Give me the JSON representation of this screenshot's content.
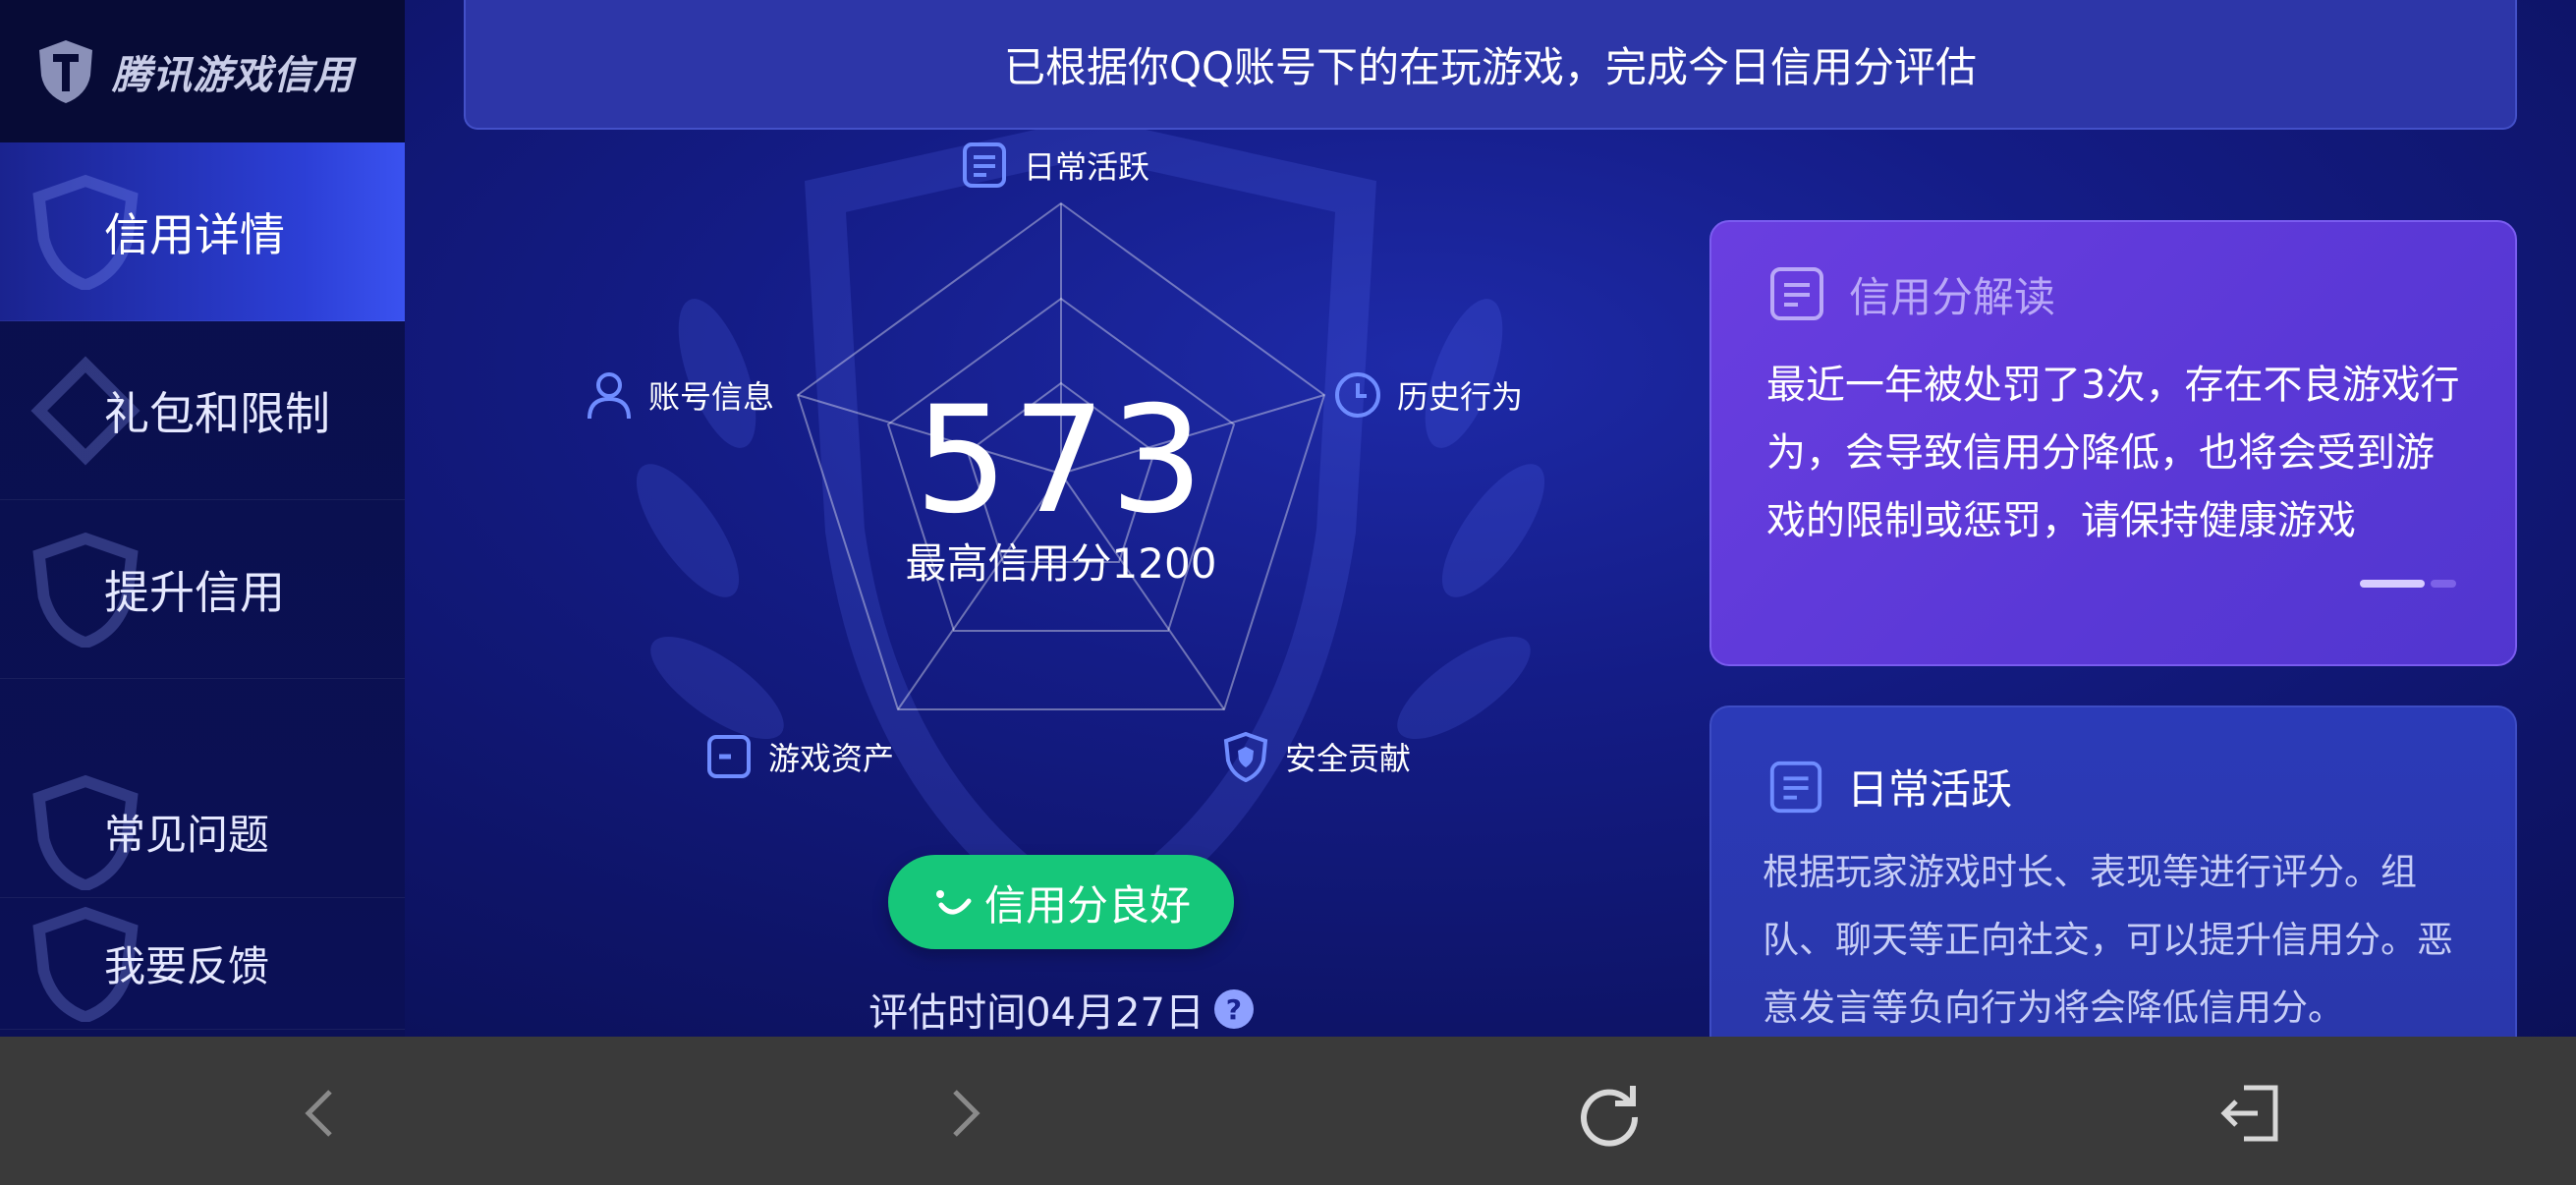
{
  "sidebar": {
    "logo_text": "腾讯游戏信用",
    "items": [
      {
        "label": "信用详情",
        "active": true
      },
      {
        "label": "礼包和限制"
      },
      {
        "label": "提升信用"
      },
      {
        "label": "常见问题"
      },
      {
        "label": "我要反馈"
      }
    ]
  },
  "banner": {
    "text": "已根据你QQ账号下的在玩游戏，完成今日信用分评估"
  },
  "radar": {
    "score": "573",
    "max_score": "最高信用分1200",
    "dimensions": {
      "daily": "日常活跃",
      "history": "历史行为",
      "security": "安全贡献",
      "assets": "游戏资产",
      "account": "账号信息"
    },
    "status_button": "信用分良好",
    "eval_time": "评估时间04月27日",
    "help_glyph": "?"
  },
  "cards": {
    "interpretation": {
      "title": "信用分解读",
      "body": "最近一年被处罚了3次，存在不良游戏行为，会导致信用分降低，也将会受到游戏的限制或惩罚，请保持健康游戏"
    },
    "daily": {
      "title": "日常活跃",
      "body": "根据玩家游戏时长、表现等进行评分。组队、聊天等正向社交，可以提升信用分。恶意发言等负向行为将会降低信用分。"
    }
  },
  "colors": {
    "accent_green": "#16c77a",
    "purple_card": "#5a38d6",
    "icon_blue": "#6f8cff"
  },
  "browser_bar": {
    "icons": [
      "back-icon",
      "forward-icon",
      "refresh-icon",
      "exit-icon"
    ]
  }
}
